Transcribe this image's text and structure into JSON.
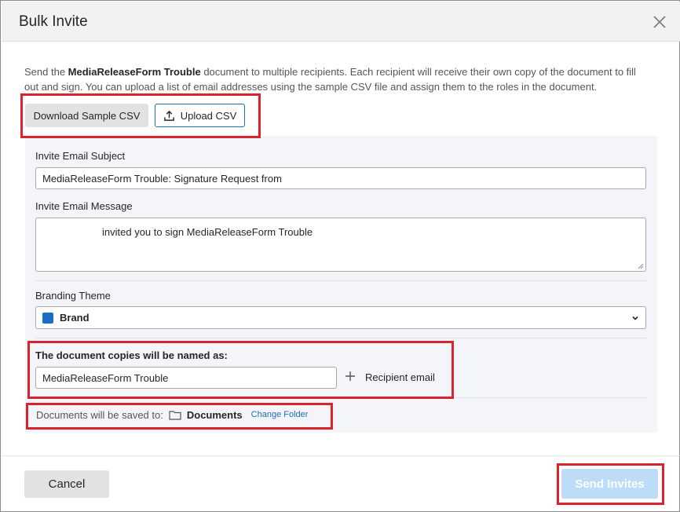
{
  "dialog": {
    "title": "Bulk Invite",
    "close_icon": "close-icon"
  },
  "description": {
    "prefix": "Send the ",
    "document_name": "MediaReleaseForm Trouble",
    "suffix": " document to multiple recipients. Each recipient will receive their own copy of the document to fill out and sign. You can upload a list of email addresses using the sample CSV file and assign them to the roles in the document."
  },
  "csv": {
    "download_label": "Download Sample CSV",
    "upload_label": "Upload CSV",
    "upload_icon": "upload-icon"
  },
  "form": {
    "subject_label": "Invite Email Subject",
    "subject_value": "MediaReleaseForm Trouble: Signature Request from",
    "message_label": "Invite Email Message",
    "message_value": "invited you to sign MediaReleaseForm Trouble",
    "branding_label": "Branding Theme",
    "branding_value": "Brand",
    "branding_color": "#1a6fc4",
    "copies_label": "The document copies will be named as:",
    "copies_value": "MediaReleaseForm Trouble",
    "recipient_label": "Recipient email",
    "saved_label": "Documents will be saved to:",
    "folder_name": "Documents",
    "change_folder_label": "Change Folder"
  },
  "footer": {
    "cancel_label": "Cancel",
    "send_label": "Send Invites"
  },
  "colors": {
    "accent": "#1f6fb7",
    "highlight": "#d9232e",
    "send_disabled": "#bcdcf7"
  }
}
